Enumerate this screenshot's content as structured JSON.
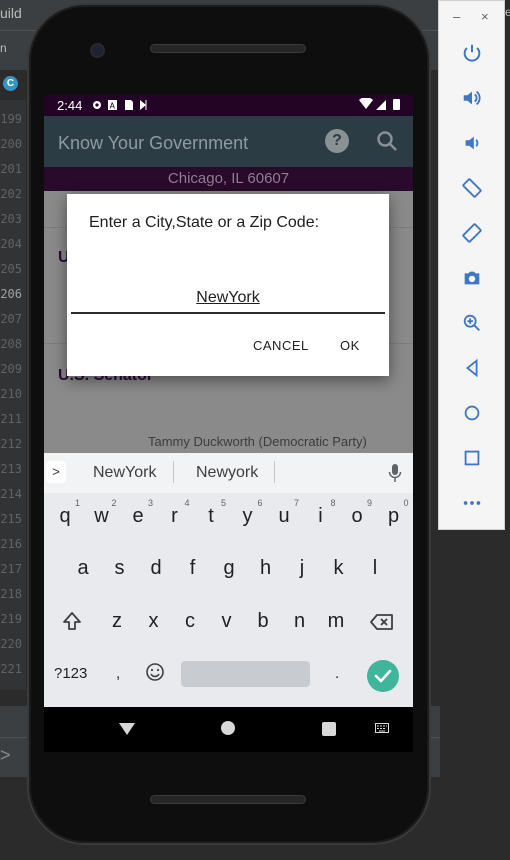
{
  "ide": {
    "menu_fragment": "uild",
    "breadcrumb_fragment": "n",
    "file_badge": "C",
    "right_fragment_1": "ers",
    "line_numbers": [
      "199",
      "200",
      "201",
      "202",
      "203",
      "204",
      "205",
      "206",
      "207",
      "208",
      "209",
      "210",
      "211",
      "212",
      "213",
      "214",
      "215",
      "216",
      "217",
      "218",
      "219",
      "220",
      "221"
    ],
    "current_line": "206"
  },
  "emulator_toolbar": {
    "minimize": "–",
    "close": "×",
    "buttons": [
      "power-icon",
      "volume-up-icon",
      "volume-down-icon",
      "rotate-left-icon",
      "rotate-right-icon",
      "camera-icon",
      "zoom-icon",
      "back-icon",
      "home-icon",
      "overview-icon",
      "more-icon"
    ],
    "accent_color": "#3f77c6"
  },
  "status_bar": {
    "time": "2:44"
  },
  "app_bar": {
    "title": "Know Your Government"
  },
  "location": "Chicago, IL 60607",
  "offices": [
    {
      "title": "U",
      "official": ""
    },
    {
      "title": "U.S. Senator",
      "official": "Tammy Duckworth (Democratic Party)"
    }
  ],
  "dialog": {
    "message": "Enter a City,State or a Zip Code:",
    "input_value": "NewYork",
    "cancel_label": "CANCEL",
    "ok_label": "OK"
  },
  "keyboard": {
    "suggestions": [
      "NewYork",
      "Newyork"
    ],
    "row1": [
      "q",
      "w",
      "e",
      "r",
      "t",
      "y",
      "u",
      "i",
      "o",
      "p"
    ],
    "row1_hints": [
      "1",
      "2",
      "3",
      "4",
      "5",
      "6",
      "7",
      "8",
      "9",
      "0"
    ],
    "row2": [
      "a",
      "s",
      "d",
      "f",
      "g",
      "h",
      "j",
      "k",
      "l"
    ],
    "row3": [
      "z",
      "x",
      "c",
      "v",
      "b",
      "n",
      "m"
    ],
    "symbols_label": "?123",
    "comma": ",",
    "period": ".",
    "enter_color": "#40b59b"
  }
}
